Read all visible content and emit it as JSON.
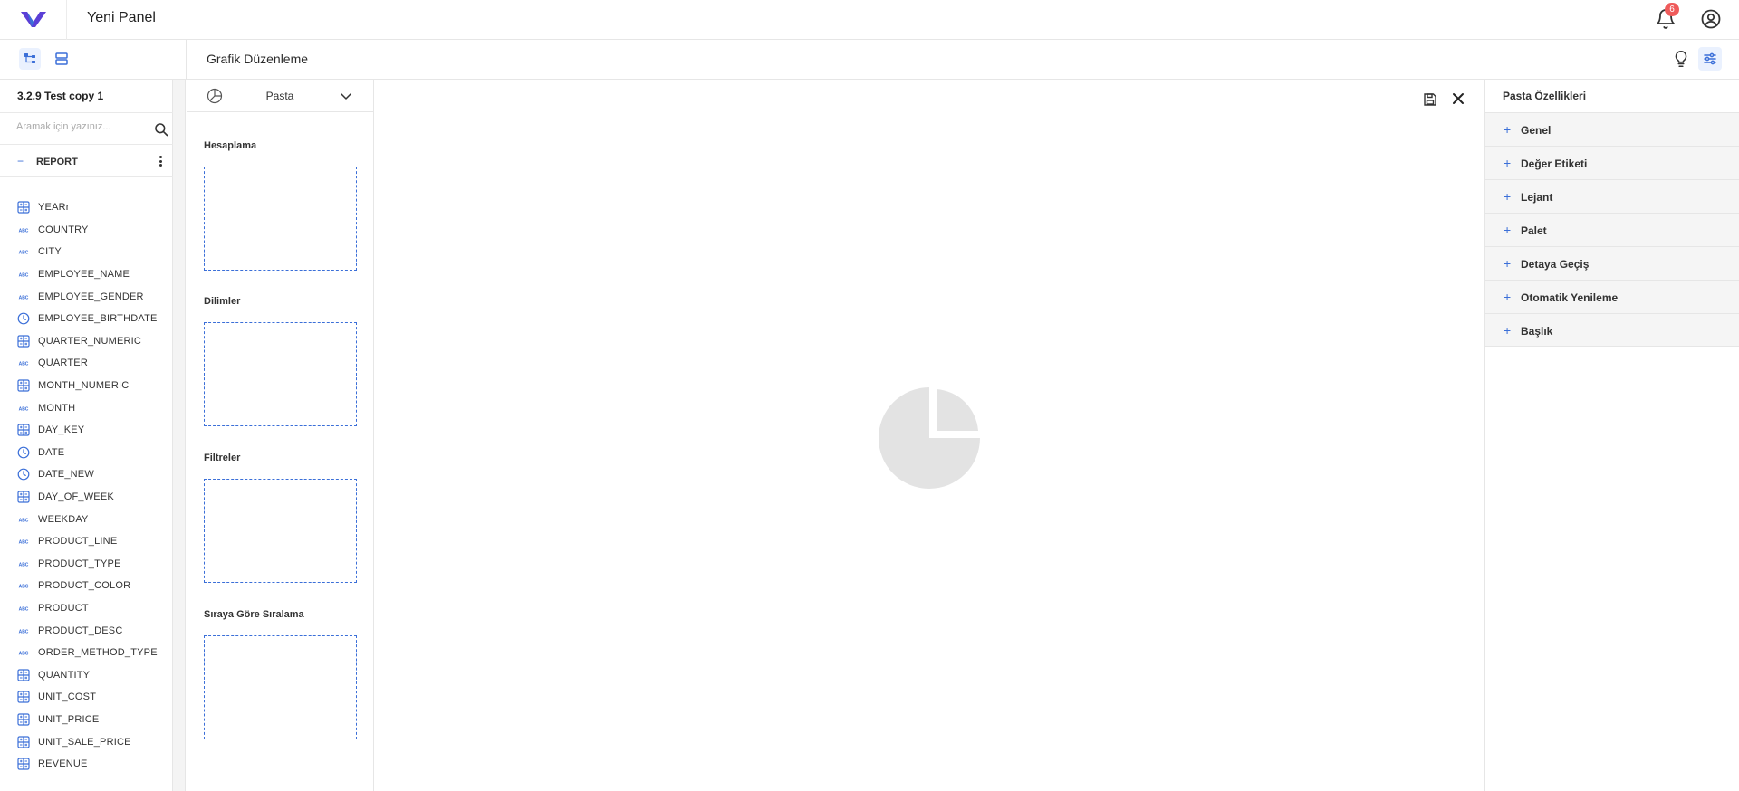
{
  "header": {
    "app_title": "Yeni Panel",
    "notification_count": "6"
  },
  "subheader": {
    "page_title": "Grafik Düzenleme"
  },
  "left_panel": {
    "report_name": "3.2.9 Test copy 1",
    "search_placeholder": "Aramak için yazınız...",
    "collapse_symbol": "−",
    "group_label": "REPORT",
    "fields": [
      {
        "name": "YEARr",
        "icon": "numeric-icon"
      },
      {
        "name": "COUNTRY",
        "icon": "text-icon"
      },
      {
        "name": "CITY",
        "icon": "text-icon"
      },
      {
        "name": "EMPLOYEE_NAME",
        "icon": "text-icon"
      },
      {
        "name": "EMPLOYEE_GENDER",
        "icon": "text-icon"
      },
      {
        "name": "EMPLOYEE_BIRTHDATE",
        "icon": "date-icon"
      },
      {
        "name": "QUARTER_NUMERIC",
        "icon": "numeric-icon"
      },
      {
        "name": "QUARTER",
        "icon": "text-icon"
      },
      {
        "name": "MONTH_NUMERIC",
        "icon": "numeric-icon"
      },
      {
        "name": "MONTH",
        "icon": "text-icon"
      },
      {
        "name": "DAY_KEY",
        "icon": "numeric-icon"
      },
      {
        "name": "DATE",
        "icon": "date-icon"
      },
      {
        "name": "DATE_NEW",
        "icon": "date-icon"
      },
      {
        "name": "DAY_OF_WEEK",
        "icon": "numeric-icon"
      },
      {
        "name": "WEEKDAY",
        "icon": "text-icon"
      },
      {
        "name": "PRODUCT_LINE",
        "icon": "text-icon"
      },
      {
        "name": "PRODUCT_TYPE",
        "icon": "text-icon"
      },
      {
        "name": "PRODUCT_COLOR",
        "icon": "text-icon"
      },
      {
        "name": "PRODUCT",
        "icon": "text-icon"
      },
      {
        "name": "PRODUCT_DESC",
        "icon": "text-icon"
      },
      {
        "name": "ORDER_METHOD_TYPE",
        "icon": "text-icon"
      },
      {
        "name": "QUANTITY",
        "icon": "numeric-icon"
      },
      {
        "name": "UNIT_COST",
        "icon": "numeric-icon"
      },
      {
        "name": "UNIT_PRICE",
        "icon": "numeric-icon"
      },
      {
        "name": "UNIT_SALE_PRICE",
        "icon": "numeric-icon"
      },
      {
        "name": "REVENUE",
        "icon": "numeric-icon"
      }
    ]
  },
  "config": {
    "chart_type": "Pasta",
    "sections": [
      "Hesaplama",
      "Dilimler",
      "Filtreler",
      "Sıraya Göre Sıralama"
    ]
  },
  "properties": {
    "title": "Pasta Özellikleri",
    "items": [
      "Genel",
      "Değer Etiketi",
      "Lejant",
      "Palet",
      "Detaya Geçiş",
      "Otomatik Yenileme",
      "Başlık"
    ]
  },
  "colors": {
    "accent": "#3b6fd8",
    "badge": "#ef5b5b",
    "placeholder_chart": "#e3e3e3"
  }
}
